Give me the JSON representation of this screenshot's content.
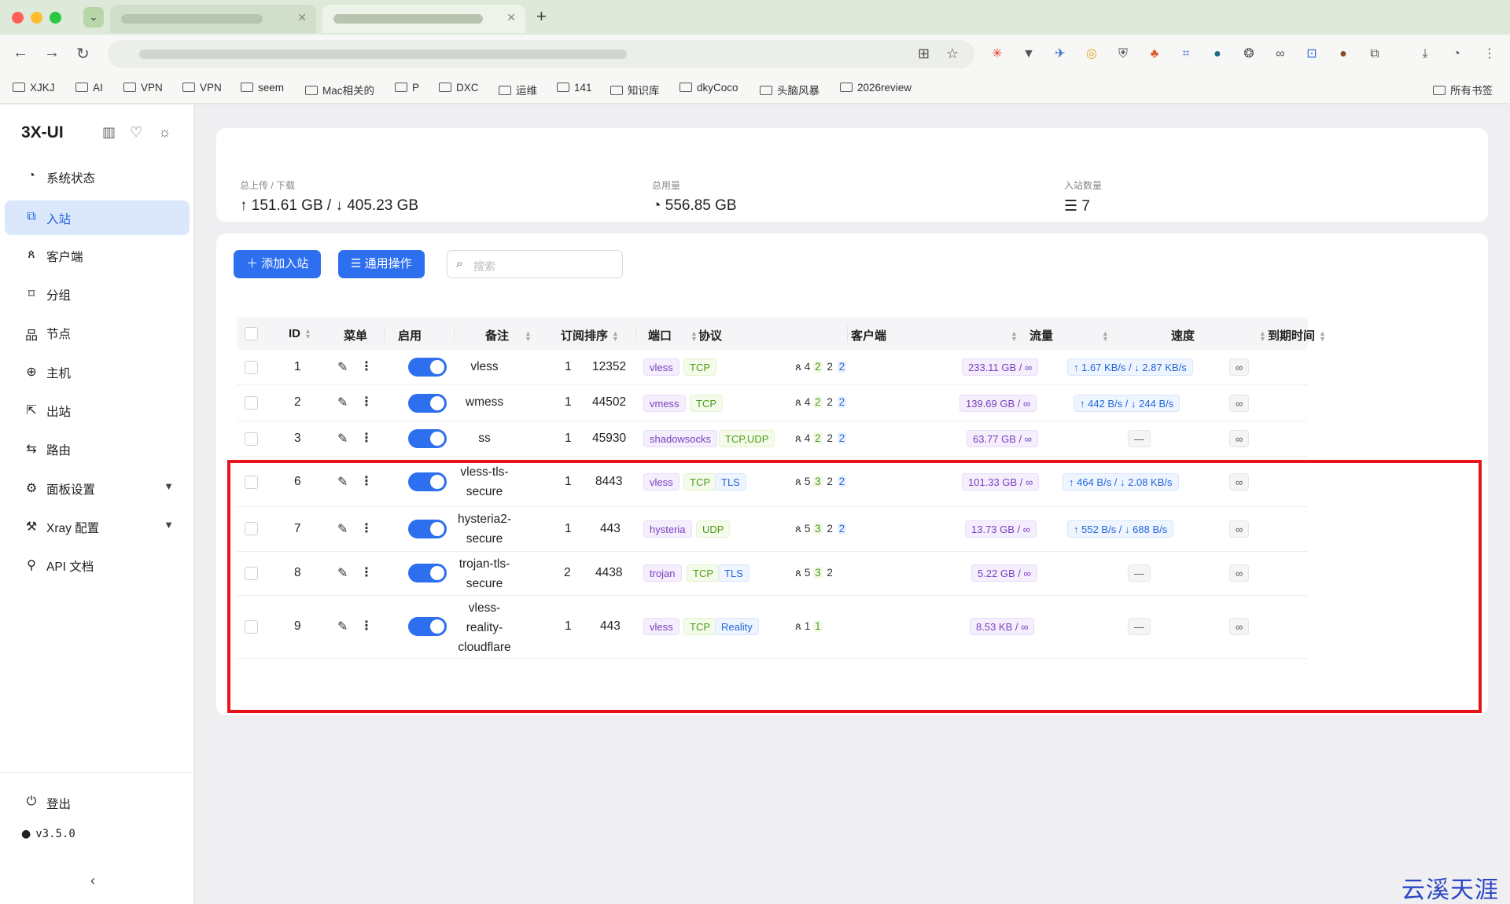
{
  "bookmarks": [
    "XJKJ",
    "AI",
    "VPN",
    "VPN",
    "seem",
    "Mac相关的",
    "P",
    "DXC",
    "运维",
    "141",
    "知识库",
    "dkyCoco",
    "头脑风暴",
    "2026review"
  ],
  "bookmarks_right": "所有书签",
  "sidebar": {
    "brand": "3X-UI",
    "items": [
      {
        "label": "系统状态",
        "icon": "dashboard-icon"
      },
      {
        "label": "入站",
        "icon": "inbound-icon",
        "active": true
      },
      {
        "label": "客户端",
        "icon": "users-icon"
      },
      {
        "label": "分组",
        "icon": "tag-icon"
      },
      {
        "label": "节点",
        "icon": "nodes-icon"
      },
      {
        "label": "主机",
        "icon": "globe-icon"
      },
      {
        "label": "出站",
        "icon": "outbound-icon"
      },
      {
        "label": "路由",
        "icon": "route-icon"
      },
      {
        "label": "面板设置",
        "icon": "settings-icon",
        "expandable": true
      },
      {
        "label": "Xray 配置",
        "icon": "wrench-icon",
        "expandable": true
      },
      {
        "label": "API 文档",
        "icon": "api-icon"
      }
    ],
    "logout": "登出",
    "version": "v3.5.0"
  },
  "stats": {
    "traffic_label": "总上传 / 下载",
    "traffic_value": "↑ 151.61 GB / ↓ 405.23 GB",
    "usage_label": "总用量",
    "usage_value": "556.85 GB",
    "inbound_count_label": "入站数量",
    "inbound_count_value": "7"
  },
  "actions": {
    "add_inbound": "添加入站",
    "general_ops": "通用操作",
    "search_placeholder": "搜索"
  },
  "table": {
    "headers": [
      "ID",
      "菜单",
      "启用",
      "备注",
      "订阅排序",
      "端口",
      "协议",
      "客户端",
      "流量",
      "速度",
      "到期时间"
    ],
    "rows": [
      {
        "id": "1",
        "remark": [
          "vless"
        ],
        "sort": "1",
        "port": "12352",
        "protocol": [
          "vless",
          "TCP"
        ],
        "clients": [
          "4",
          "2",
          "2",
          "2"
        ],
        "traffic": "233.11 GB / ∞",
        "speed": "↑ 1.67 KB/s / ↓ 2.87 KB/s",
        "expiry": "∞"
      },
      {
        "id": "2",
        "remark": [
          "wmess"
        ],
        "sort": "1",
        "port": "44502",
        "protocol": [
          "vmess",
          "TCP"
        ],
        "clients": [
          "4",
          "2",
          "2",
          "2"
        ],
        "traffic": "139.69 GB / ∞",
        "speed": "↑ 442 B/s / ↓ 244 B/s",
        "expiry": "∞"
      },
      {
        "id": "3",
        "remark": [
          "ss"
        ],
        "sort": "1",
        "port": "45930",
        "protocol": [
          "shadowsocks",
          "TCP,UDP"
        ],
        "clients": [
          "4",
          "2",
          "2",
          "2"
        ],
        "traffic": "63.77 GB / ∞",
        "speed": "—",
        "expiry": "∞"
      },
      {
        "id": "6",
        "remark": [
          "vless-tls-",
          "secure"
        ],
        "sort": "1",
        "port": "8443",
        "protocol": [
          "vless",
          "TCP",
          "TLS"
        ],
        "clients": [
          "5",
          "3",
          "2",
          "2"
        ],
        "traffic": "101.33 GB / ∞",
        "speed": "↑ 464 B/s / ↓ 2.08 KB/s",
        "expiry": "∞"
      },
      {
        "id": "7",
        "remark": [
          "hysteria2-",
          "secure"
        ],
        "sort": "1",
        "port": "443",
        "protocol": [
          "hysteria",
          "UDP"
        ],
        "clients": [
          "5",
          "3",
          "2",
          "2"
        ],
        "traffic": "13.73 GB / ∞",
        "speed": "↑ 552 B/s / ↓ 688 B/s",
        "expiry": "∞"
      },
      {
        "id": "8",
        "remark": [
          "trojan-tls-",
          "secure"
        ],
        "sort": "2",
        "port": "4438",
        "protocol": [
          "trojan",
          "TCP",
          "TLS"
        ],
        "clients": [
          "5",
          "3",
          "2"
        ],
        "traffic": "5.22 GB / ∞",
        "speed": "—",
        "expiry": "∞"
      },
      {
        "id": "9",
        "remark": [
          "vless-",
          "reality-",
          "cloudflare"
        ],
        "sort": "1",
        "port": "443",
        "protocol": [
          "vless",
          "TCP",
          "Reality"
        ],
        "clients": [
          "1",
          "1"
        ],
        "traffic": "8.53 KB / ∞",
        "speed": "—",
        "expiry": "∞"
      }
    ]
  },
  "watermark": "云溪天涯"
}
